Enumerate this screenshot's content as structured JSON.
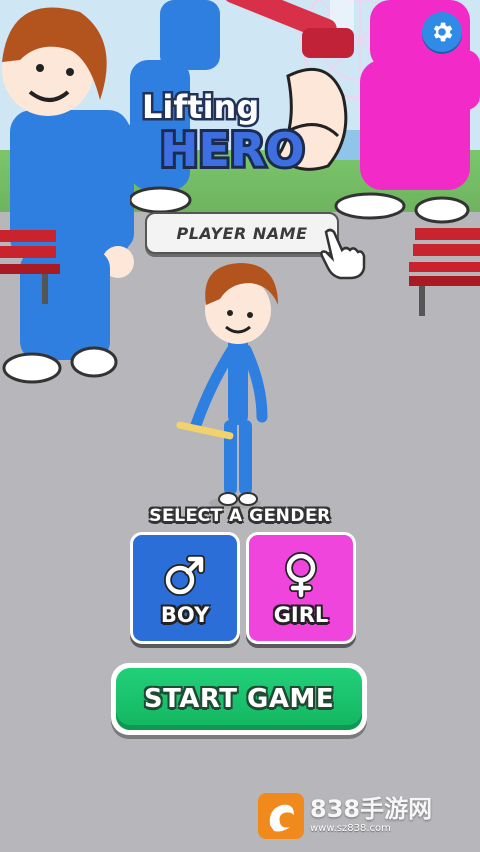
{
  "logo": {
    "line1": "Lifting",
    "line2": "HERO"
  },
  "name_field": {
    "placeholder": "PLAYER NAME"
  },
  "gender": {
    "heading": "SELECT A GENDER",
    "boy_label": "BOY",
    "girl_label": "GIRL"
  },
  "start_label": "START GAME",
  "watermark": {
    "brand": "838手游网",
    "url": "www.sz838.com"
  },
  "colors": {
    "settings_bg": "#2f8be6",
    "boy_bg": "#2c6ed8",
    "girl_bg": "#ef45dc",
    "start_bg": "#13b560",
    "character_blue": "#2f7fe0",
    "bystander_pink": "#f22ac8"
  },
  "icons": {
    "settings": "gear-icon",
    "boy": "male-symbol-icon",
    "girl": "female-symbol-icon",
    "pointer": "pointing-hand-icon"
  }
}
